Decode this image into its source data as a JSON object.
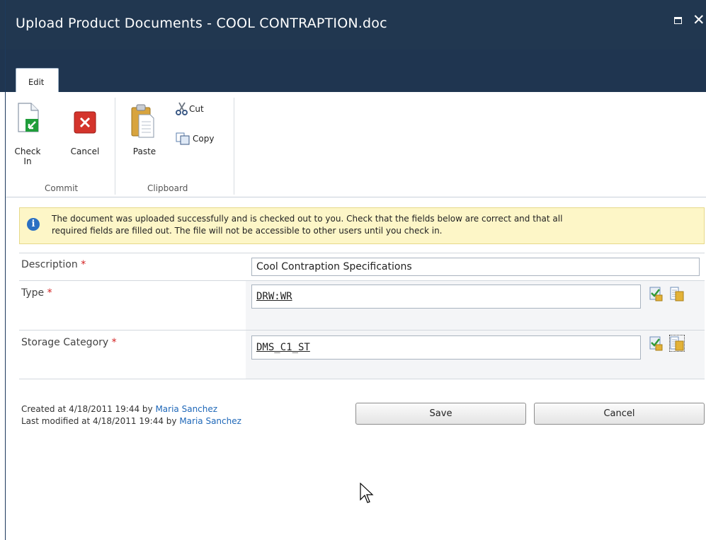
{
  "dialog": {
    "title": "Upload Product Documents - COOL CONTRAPTION.doc"
  },
  "ribbon": {
    "tab_label": "Edit",
    "commit": {
      "group_label": "Commit",
      "check_in_label_line1": "Check",
      "check_in_label_line2": "In",
      "cancel_label": "Cancel"
    },
    "clipboard": {
      "group_label": "Clipboard",
      "paste_label": "Paste",
      "cut_label": "Cut",
      "copy_label": "Copy"
    }
  },
  "info_message": {
    "line1": "The document was uploaded successfully and is checked out to you. Check that the fields below are correct and that all",
    "line2": "required fields are filled out. The file will not be accessible to other users until you check in."
  },
  "form": {
    "required_marker": "*",
    "description": {
      "label": "Description",
      "value": "Cool Contraption Specifications"
    },
    "type": {
      "label": "Type",
      "value": "DRW:WR"
    },
    "storage_category": {
      "label": "Storage Category",
      "value": "DMS_C1_ST"
    }
  },
  "footer": {
    "created_prefix": "Created at 4/18/2011 19:44 by ",
    "created_by": "Maria Sanchez",
    "modified_prefix": "Last modified at 4/18/2011 19:44 by ",
    "modified_by": "Maria Sanchez",
    "save_label": "Save",
    "cancel_label": "Cancel"
  },
  "colors": {
    "titlebar": "#213750",
    "info_background": "#fdf6c7",
    "required": "#d32020",
    "link": "#1e67b8"
  }
}
